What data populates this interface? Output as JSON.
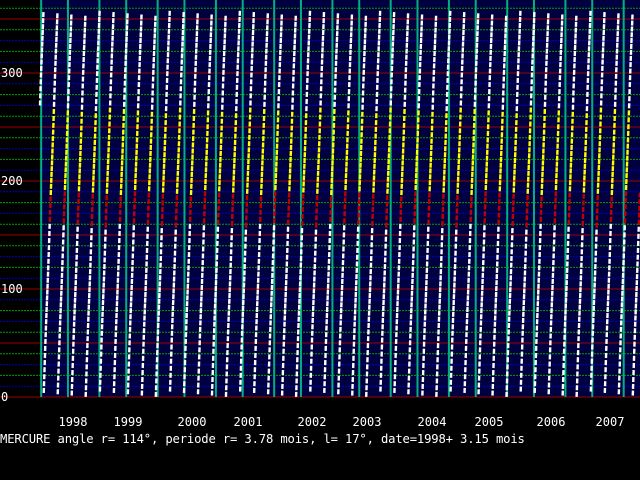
{
  "chart_data": {
    "type": "line",
    "title": "",
    "xlabel": "",
    "ylabel": "",
    "xlim": [
      1997.5,
      2007.8
    ],
    "ylim": [
      0,
      360
    ],
    "y_ticks": [
      0,
      100,
      200,
      300
    ],
    "y_tick_labels": [
      "0",
      "100",
      "200",
      "300"
    ],
    "x_tick_labels": [
      {
        "label": "1998",
        "x": 1998.0
      },
      {
        "label": "1999",
        "x": 1999.0
      },
      {
        "label": "2000",
        "x": 2000.0
      },
      {
        "label": "2001",
        "x": 2001.0
      },
      {
        "label": "2002",
        "x": 2002.0
      },
      {
        "label": "2003",
        "x": 2003.0
      },
      {
        "label": "2004",
        "x": 2004.0
      },
      {
        "label": "2005",
        "x": 2005.0
      },
      {
        "label": "2006",
        "x": 2006.0
      },
      {
        "label": "2007",
        "x": 2007.0
      }
    ],
    "grid": true,
    "vertical_markers": [
      1997.52,
      1997.98,
      1998.52,
      1998.98,
      1999.52,
      1999.98,
      2000.52,
      2000.98,
      2001.52,
      2001.98,
      2002.52,
      2002.98,
      2003.52,
      2003.98,
      2004.52,
      2004.98,
      2005.52,
      2005.98,
      2006.52,
      2006.98,
      2007.52
    ],
    "series": [
      {
        "type": "sawtooth",
        "x_start": 1997.5,
        "x_end": 2007.8,
        "y_start": 270,
        "period_years": 0.2408,
        "retrograde_dip": 12,
        "range_per_period": 360
      }
    ],
    "colors": {
      "background": "#000040",
      "major_grid": "#a00000",
      "minor_grid": "#00a000",
      "minor_grid_alt": "#0000c0",
      "vertical_marker": "#00b080",
      "curve_main": "#ffffff",
      "curve_alt": "#ffff00",
      "curve_shade": "#c00000"
    }
  },
  "status_line": "MERCURE angle r= 114°, periode r= 3.78 mois, l= 17°, date=1998+ 3.15 mois"
}
